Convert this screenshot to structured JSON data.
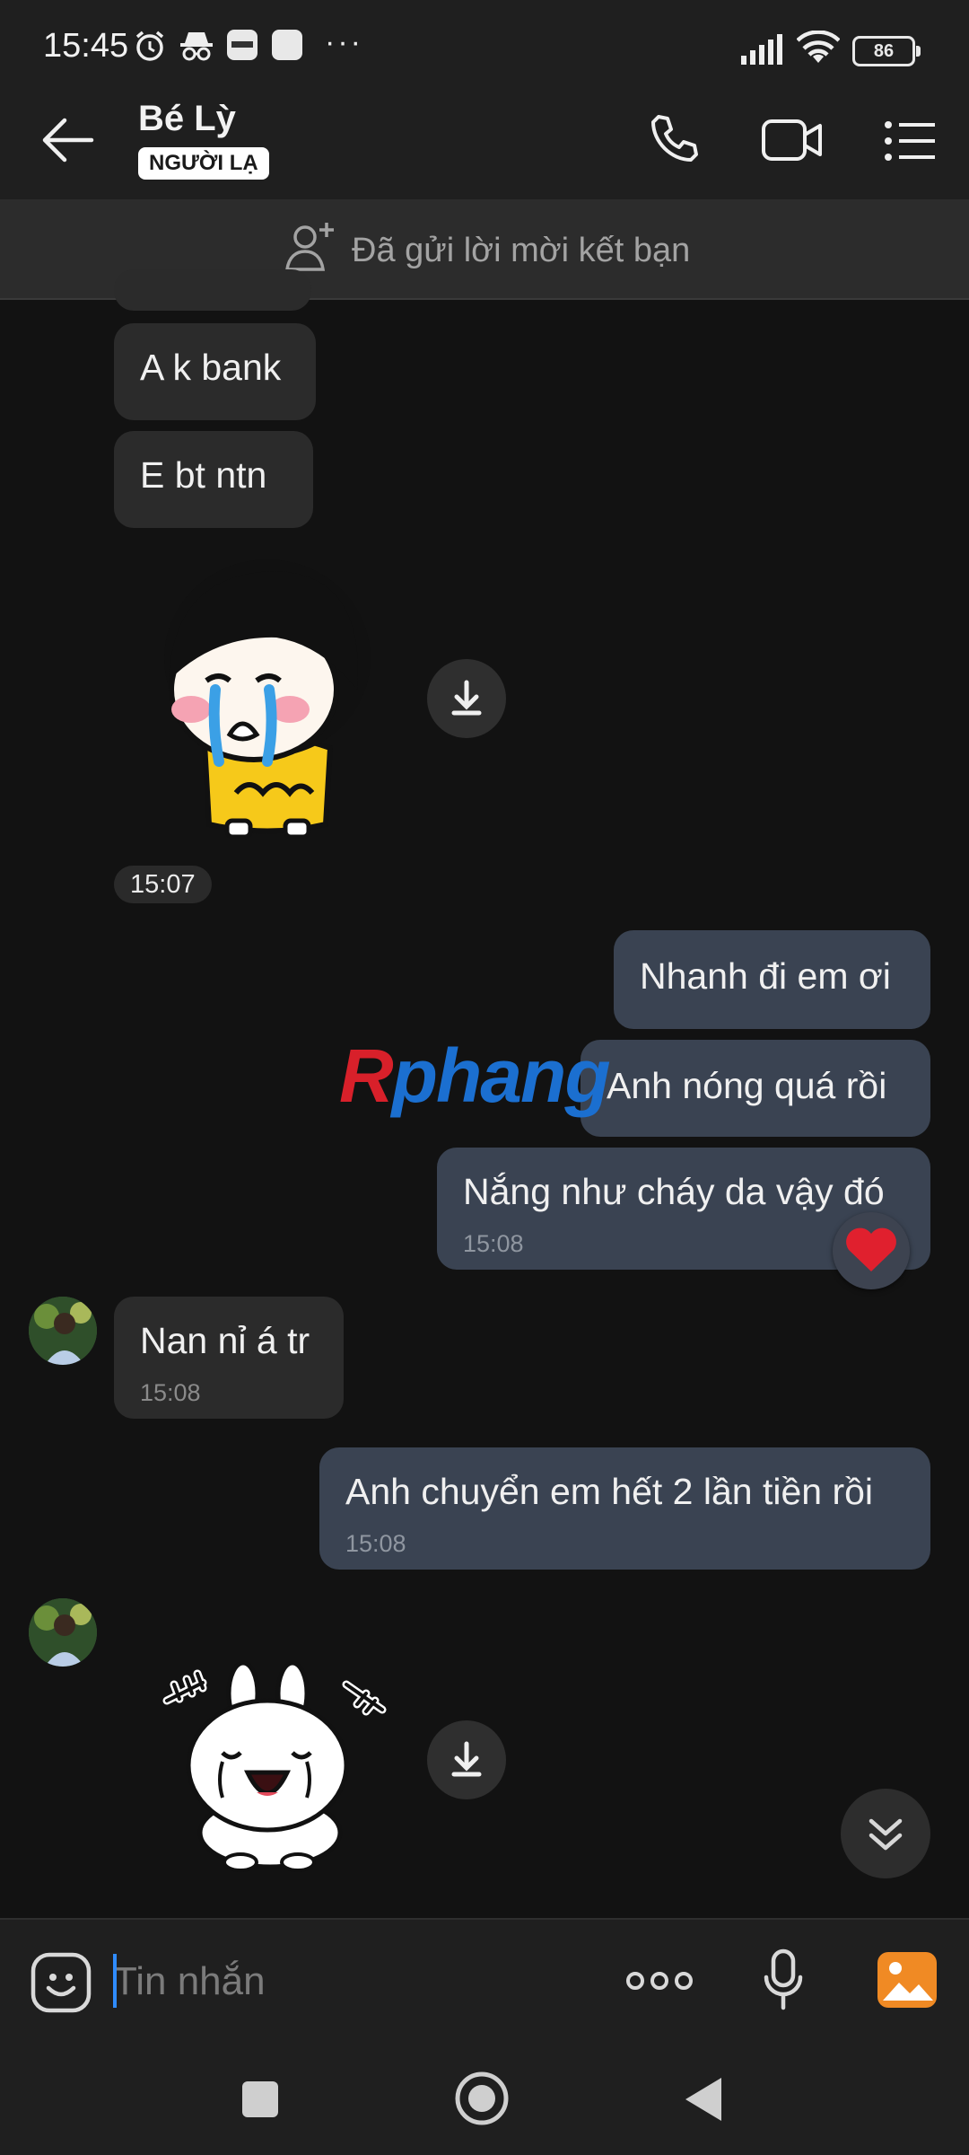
{
  "status_bar": {
    "time": "15:45",
    "battery_level": "86",
    "more_glyph": "···",
    "icons": [
      "alarm-icon",
      "incognito-icon",
      "app-notification-icon",
      "app-notification-icon",
      "signal-icon",
      "wifi-icon",
      "battery-icon"
    ]
  },
  "header": {
    "contact_name": "Bé Lỳ",
    "badge": "NGƯỜI LẠ",
    "icons": [
      "back-arrow-icon",
      "phone-icon",
      "video-call-icon",
      "menu-list-icon"
    ]
  },
  "friend_request": {
    "text": "Đã gửi lời mời kết bạn",
    "icon": "add-friend-icon"
  },
  "messages": [
    {
      "direction": "incoming",
      "type": "text",
      "text": "A k bank",
      "time": ""
    },
    {
      "direction": "incoming",
      "type": "text",
      "text": "E bt ntn",
      "time": ""
    },
    {
      "direction": "incoming",
      "type": "sticker",
      "sticker": "crying-girl-sticker"
    },
    {
      "direction": "outgoing",
      "type": "text",
      "text": "Nhanh đi em ơi",
      "time": ""
    },
    {
      "direction": "outgoing",
      "type": "text",
      "text": "Anh nóng quá rồi",
      "time": ""
    },
    {
      "direction": "outgoing",
      "type": "text",
      "text": "Nắng như cháy da vậy đó",
      "time": "15:08",
      "reaction": "heart-icon"
    },
    {
      "direction": "incoming",
      "type": "text",
      "text": "Nan nỉ á tr",
      "time": "15:08"
    },
    {
      "direction": "outgoing",
      "type": "text",
      "text": "Anh chuyển em hết 2 lần tiền rồi",
      "time": "15:08"
    },
    {
      "direction": "incoming",
      "type": "sticker",
      "sticker": "laughing-bunny-sticker"
    }
  ],
  "time_chip": "15:07",
  "watermark": {
    "part1": "R",
    "part2": "phang"
  },
  "composer": {
    "placeholder": "Tin nhắn",
    "icons": [
      "emoji-icon",
      "more-options-icon",
      "microphone-icon",
      "gallery-icon"
    ]
  },
  "colors": {
    "background": "#121212",
    "incoming_bubble": "#2b2b2b",
    "outgoing_bubble": "#3a4352",
    "accent": "#2f8cff",
    "heart": "#e0202e",
    "gallery": "#f08a24"
  },
  "nav_bar": {
    "icons": [
      "recent-apps-icon",
      "home-icon",
      "back-icon"
    ]
  }
}
